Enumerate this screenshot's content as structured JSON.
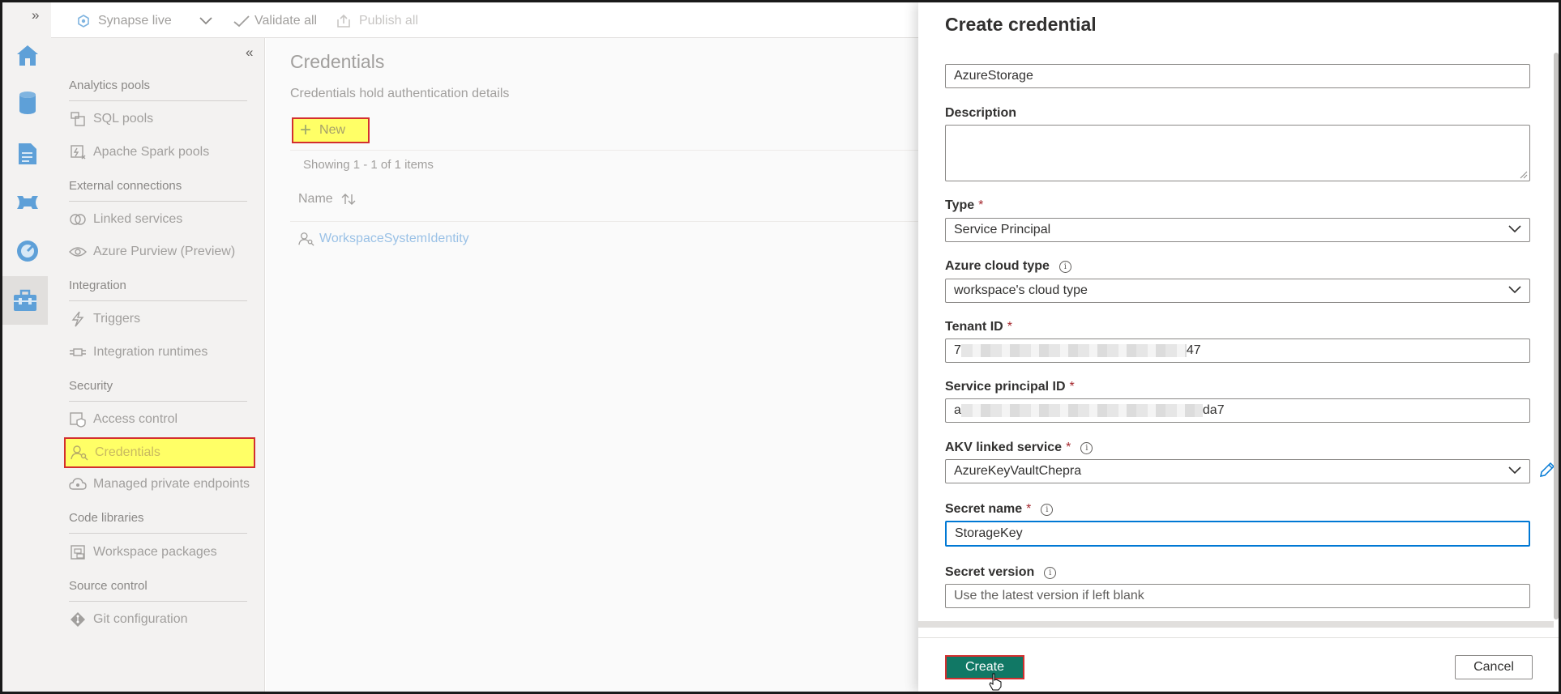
{
  "toolbar": {
    "workspace_label": "Synapse live",
    "validate_label": "Validate all",
    "publish_label": "Publish all"
  },
  "rail": {
    "expand_glyph": "»",
    "icons": [
      "home-icon",
      "data-icon",
      "develop-icon",
      "integrate-icon",
      "monitor-icon",
      "manage-icon"
    ]
  },
  "nav": {
    "collapse_glyph": "«",
    "sections": [
      {
        "title": "Analytics pools",
        "items": [
          "SQL pools",
          "Apache Spark pools"
        ]
      },
      {
        "title": "External connections",
        "items": [
          "Linked services",
          "Azure Purview (Preview)"
        ]
      },
      {
        "title": "Integration",
        "items": [
          "Triggers",
          "Integration runtimes"
        ]
      },
      {
        "title": "Security",
        "items": [
          "Access control",
          "Credentials",
          "Managed private endpoints"
        ]
      },
      {
        "title": "Code libraries",
        "items": [
          "Workspace packages"
        ]
      },
      {
        "title": "Source control",
        "items": [
          "Git configuration"
        ]
      }
    ],
    "selected": "Credentials"
  },
  "main": {
    "title": "Credentials",
    "description": "Credentials hold authentication details",
    "new_label": "New",
    "showing": "Showing 1 - 1 of 1 items",
    "column_name": "Name",
    "rows": [
      "WorkspaceSystemIdentity"
    ]
  },
  "panel": {
    "title": "Create credential",
    "name_value": "AzureStorage",
    "description_label": "Description",
    "description_value": "",
    "type_label": "Type",
    "type_value": "Service Principal",
    "cloud_label": "Azure cloud type",
    "cloud_value": "workspace's cloud type",
    "tenant_label": "Tenant ID",
    "tenant_prefix": "7",
    "tenant_suffix": "47",
    "sp_label": "Service principal ID",
    "sp_prefix": "a",
    "sp_suffix": "da7",
    "akv_label": "AKV linked service",
    "akv_value": "AzureKeyVaultChepra",
    "secret_label": "Secret name",
    "secret_value": "StorageKey",
    "version_label": "Secret version",
    "version_placeholder": "Use the latest version if left blank",
    "create_label": "Create",
    "cancel_label": "Cancel",
    "required_mark": "*",
    "info_glyph": "i"
  },
  "colors": {
    "primary": "#117865",
    "highlight": "#ffff66",
    "highlight_border": "#d32f2f",
    "focus": "#0078d4",
    "link": "#9ac1e6"
  }
}
